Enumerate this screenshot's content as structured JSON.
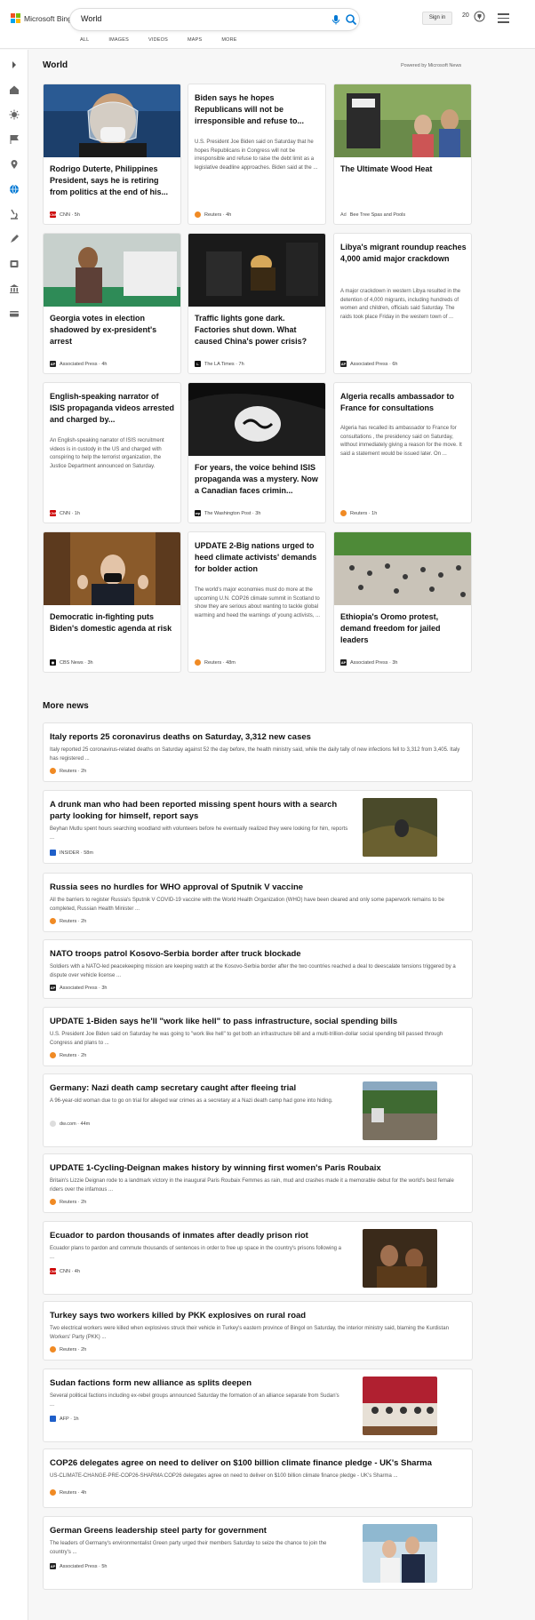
{
  "header": {
    "brand": "Microsoft Bing",
    "query": "World",
    "scopes": [
      "ALL",
      "IMAGES",
      "VIDEOS",
      "MAPS",
      "MORE"
    ],
    "sign_in": "Sign in",
    "rewards_count": "20"
  },
  "world": {
    "title": "World",
    "powered": "Powered by Microsoft News",
    "cards": [
      {
        "title": "Rodrigo Duterte, Philippines President, says he is retiring from politics at the end of his...",
        "snippet": "",
        "source": "CNN",
        "time": "5h",
        "meta": "CNN · 5h",
        "logo_color": "#cc0000",
        "logo_text": "CNN"
      },
      {
        "title": "Biden says he hopes Republicans will not be irresponsible and refuse to...",
        "snippet": "U.S. President Joe Biden said on Saturday that he hopes Republicans in Congress will not be irresponsible and refuse to raise the debt limit as a legislative deadline approaches. Biden said at the ...",
        "source": "Reuters",
        "time": "4h",
        "meta": "Reuters · 4h",
        "logo_color": "#f08a24",
        "logo_text": ""
      },
      {
        "title": "The Ultimate Wood Heat",
        "snippet": "",
        "source": "Bee Tree Spas and Pools",
        "time": "",
        "meta": "Bee Tree Spas and Pools",
        "ad": "Ad",
        "logo_color": "",
        "logo_text": ""
      },
      {
        "title": "Georgia votes in election shadowed by ex-president's arrest",
        "snippet": "",
        "source": "Associated Press",
        "time": "4h",
        "meta": "Associated Press · 4h",
        "logo_color": "#222",
        "logo_text": "AP"
      },
      {
        "title": "Traffic lights gone dark. Factories shut down. What caused China's power crisis?",
        "snippet": "",
        "source": "The LA Times",
        "time": "7h",
        "meta": "The LA Times · 7h",
        "logo_color": "#111",
        "logo_text": "L"
      },
      {
        "title": "Libya's migrant roundup reaches 4,000 amid major crackdown",
        "snippet": "A major crackdown in western Libya resulted in the detention of 4,000 migrants, including hundreds of women and children, officials said Saturday. The raids took place Friday in the western town of ...",
        "source": "Associated Press",
        "time": "6h",
        "meta": "Associated Press · 6h",
        "logo_color": "#222",
        "logo_text": "AP"
      },
      {
        "title": "English-speaking narrator of ISIS propaganda videos arrested and charged by...",
        "snippet": "An English-speaking narrator of ISIS recruitment videos is in custody in the US and charged with conspiring to help the terrorist organization, the Justice Department announced on Saturday.",
        "source": "CNN",
        "time": "1h",
        "meta": "CNN · 1h",
        "logo_color": "#cc0000",
        "logo_text": "CNN"
      },
      {
        "title": "For years, the voice behind ISIS propaganda was a mystery. Now a Canadian faces crimin...",
        "snippet": "",
        "source": "The Washington Post",
        "time": "3h",
        "meta": "The Washington Post · 3h",
        "logo_color": "#111",
        "logo_text": "wp"
      },
      {
        "title": "Algeria recalls ambassador to France for consultations",
        "snippet": "Algeria has recalled its ambassador to France for consultations , the presidency said on Saturday, without immediately giving a reason for the move. It said a statement would be issued later. On ...",
        "source": "Reuters",
        "time": "1h",
        "meta": "Reuters · 1h",
        "logo_color": "#f08a24",
        "logo_text": ""
      },
      {
        "title": "Democratic in-fighting puts Biden's domestic agenda at risk",
        "snippet": "",
        "source": "CBS News",
        "time": "3h",
        "meta": "CBS News · 3h",
        "logo_color": "#111",
        "logo_text": "◉"
      },
      {
        "title": "UPDATE 2-Big nations urged to heed climate activists' demands for bolder action",
        "snippet": "The world's major economies must do more at the upcoming U.N. COP26 climate summit in Scotland to show they are serious about wanting to tackle global warming and heed the warnings of young activists, ...",
        "source": "Reuters",
        "time": "48m",
        "meta": "Reuters · 48m",
        "logo_color": "#f08a24",
        "logo_text": ""
      },
      {
        "title": "Ethiopia's Oromo protest, demand freedom for jailed leaders",
        "snippet": "",
        "source": "Associated Press",
        "time": "3h",
        "meta": "Associated Press · 3h",
        "logo_color": "#222",
        "logo_text": "AP"
      }
    ]
  },
  "more_news": {
    "title": "More news",
    "items": [
      {
        "title": "Italy reports 25 coronavirus deaths on Saturday, 3,312 new cases",
        "snippet": "Italy reported 25 coronavirus-related deaths on Saturday against 52 the day before, the health ministry said, while the daily tally of new infections fell to 3,312 from 3,405. Italy has registered ...",
        "meta": "Reuters · 2h",
        "logo_color": "#f08a24",
        "logo_text": ""
      },
      {
        "title": "A drunk man who had been reported missing spent hours with a search party looking for himself, report says",
        "snippet": "Beyhan Mutlu spent hours searching woodland with volunteers before he eventually realized they were looking for him, reports ...",
        "meta": "INSIDER · 58m",
        "logo_color": "#1f5fc9",
        "logo_text": ""
      },
      {
        "title": "Russia sees no hurdles for WHO approval of Sputnik V vaccine",
        "snippet": "All the barriers to register Russia's Sputnik V COVID-19 vaccine with the World Health Organization (WHO) have been cleared and only some paperwork remains to be completed, Russian Health Minister ...",
        "meta": "Reuters · 2h",
        "logo_color": "#f08a24",
        "logo_text": ""
      },
      {
        "title": "NATO troops patrol Kosovo-Serbia border after truck blockade",
        "snippet": "Soldiers with a NATO-led peacekeeping mission are keeping watch at the Kosovo-Serbia border after the two countries reached a deal to deescalate tensions triggered by a dispute over vehicle license ...",
        "meta": "Associated Press · 3h",
        "logo_color": "#222",
        "logo_text": "AP"
      },
      {
        "title": "UPDATE 1-Biden says he'll \"work like hell\" to pass infrastructure, social spending bills",
        "snippet": "U.S. President Joe Biden said on Saturday he was going to \"work like hell\" to get both an infrastructure bill and a multi-trillion-dollar social spending bill passed through Congress and plans to ...",
        "meta": "Reuters · 2h",
        "logo_color": "#f08a24",
        "logo_text": ""
      },
      {
        "title": "Germany: Nazi death camp secretary caught after fleeing trial",
        "snippet": "A 96-year-old woman due to go on trial for alleged war crimes as a secretary at a Nazi death camp had gone into hiding.",
        "meta": "dw.com · 44m",
        "logo_color": "#ccc",
        "logo_text": ""
      },
      {
        "title": "UPDATE 1-Cycling-Deignan makes history by winning first women's Paris Roubaix",
        "snippet": "Britain's Lizzie Deignan rode to a landmark victory in the inaugural Paris Roubaix Femmes as rain, mud and crashes made it a memorable debut for the world's best female riders over the infamous ...",
        "meta": "Reuters · 2h",
        "logo_color": "#f08a24",
        "logo_text": ""
      },
      {
        "title": "Ecuador to pardon thousands of inmates after deadly prison riot",
        "snippet": "Ecuador plans to pardon and commute thousands of sentences in order to free up space in the country's prisons following a ...",
        "meta": "CNN · 4h",
        "logo_color": "#cc0000",
        "logo_text": "CNN"
      },
      {
        "title": "Turkey says two workers killed by PKK explosives on rural road",
        "snippet": "Two electrical workers were killed when explosives struck their vehicle in Turkey's eastern province of Bingol on Saturday, the interior ministry said, blaming the Kurdistan Workers' Party (PKK) ...",
        "meta": "Reuters · 2h",
        "logo_color": "#f08a24",
        "logo_text": ""
      },
      {
        "title": "Sudan factions form new alliance as splits deepen",
        "snippet": "Several political factions including ex-rebel groups announced Saturday the formation of an alliance separate from Sudan's ...",
        "meta": "AFP · 1h",
        "logo_color": "#1f5fc9",
        "logo_text": "AFP"
      },
      {
        "title": "COP26 delegates agree on need to deliver on $100 billion climate finance pledge - UK's Sharma",
        "snippet": "US-CLIMATE-CHANGE-PRE-COP26-SHARMA:COP26 delegates agree on need to deliver on $100 billion climate finance pledge - UK's Sharma ...",
        "meta": "Reuters · 4h",
        "logo_color": "#f08a24",
        "logo_text": ""
      },
      {
        "title": "German Greens leadership steel party for government",
        "snippet": "The leaders of Germany's environmentalist Green party urged their members Saturday to seize the chance to join the country's ...",
        "meta": "Associated Press · 5h",
        "logo_color": "#222",
        "logo_text": "AP"
      }
    ]
  },
  "colors": {
    "accent": "#0078d4",
    "bing_red": "#f25022",
    "bing_green": "#7fba00",
    "bing_blue": "#00a4ef",
    "bing_yellow": "#ffb900"
  }
}
